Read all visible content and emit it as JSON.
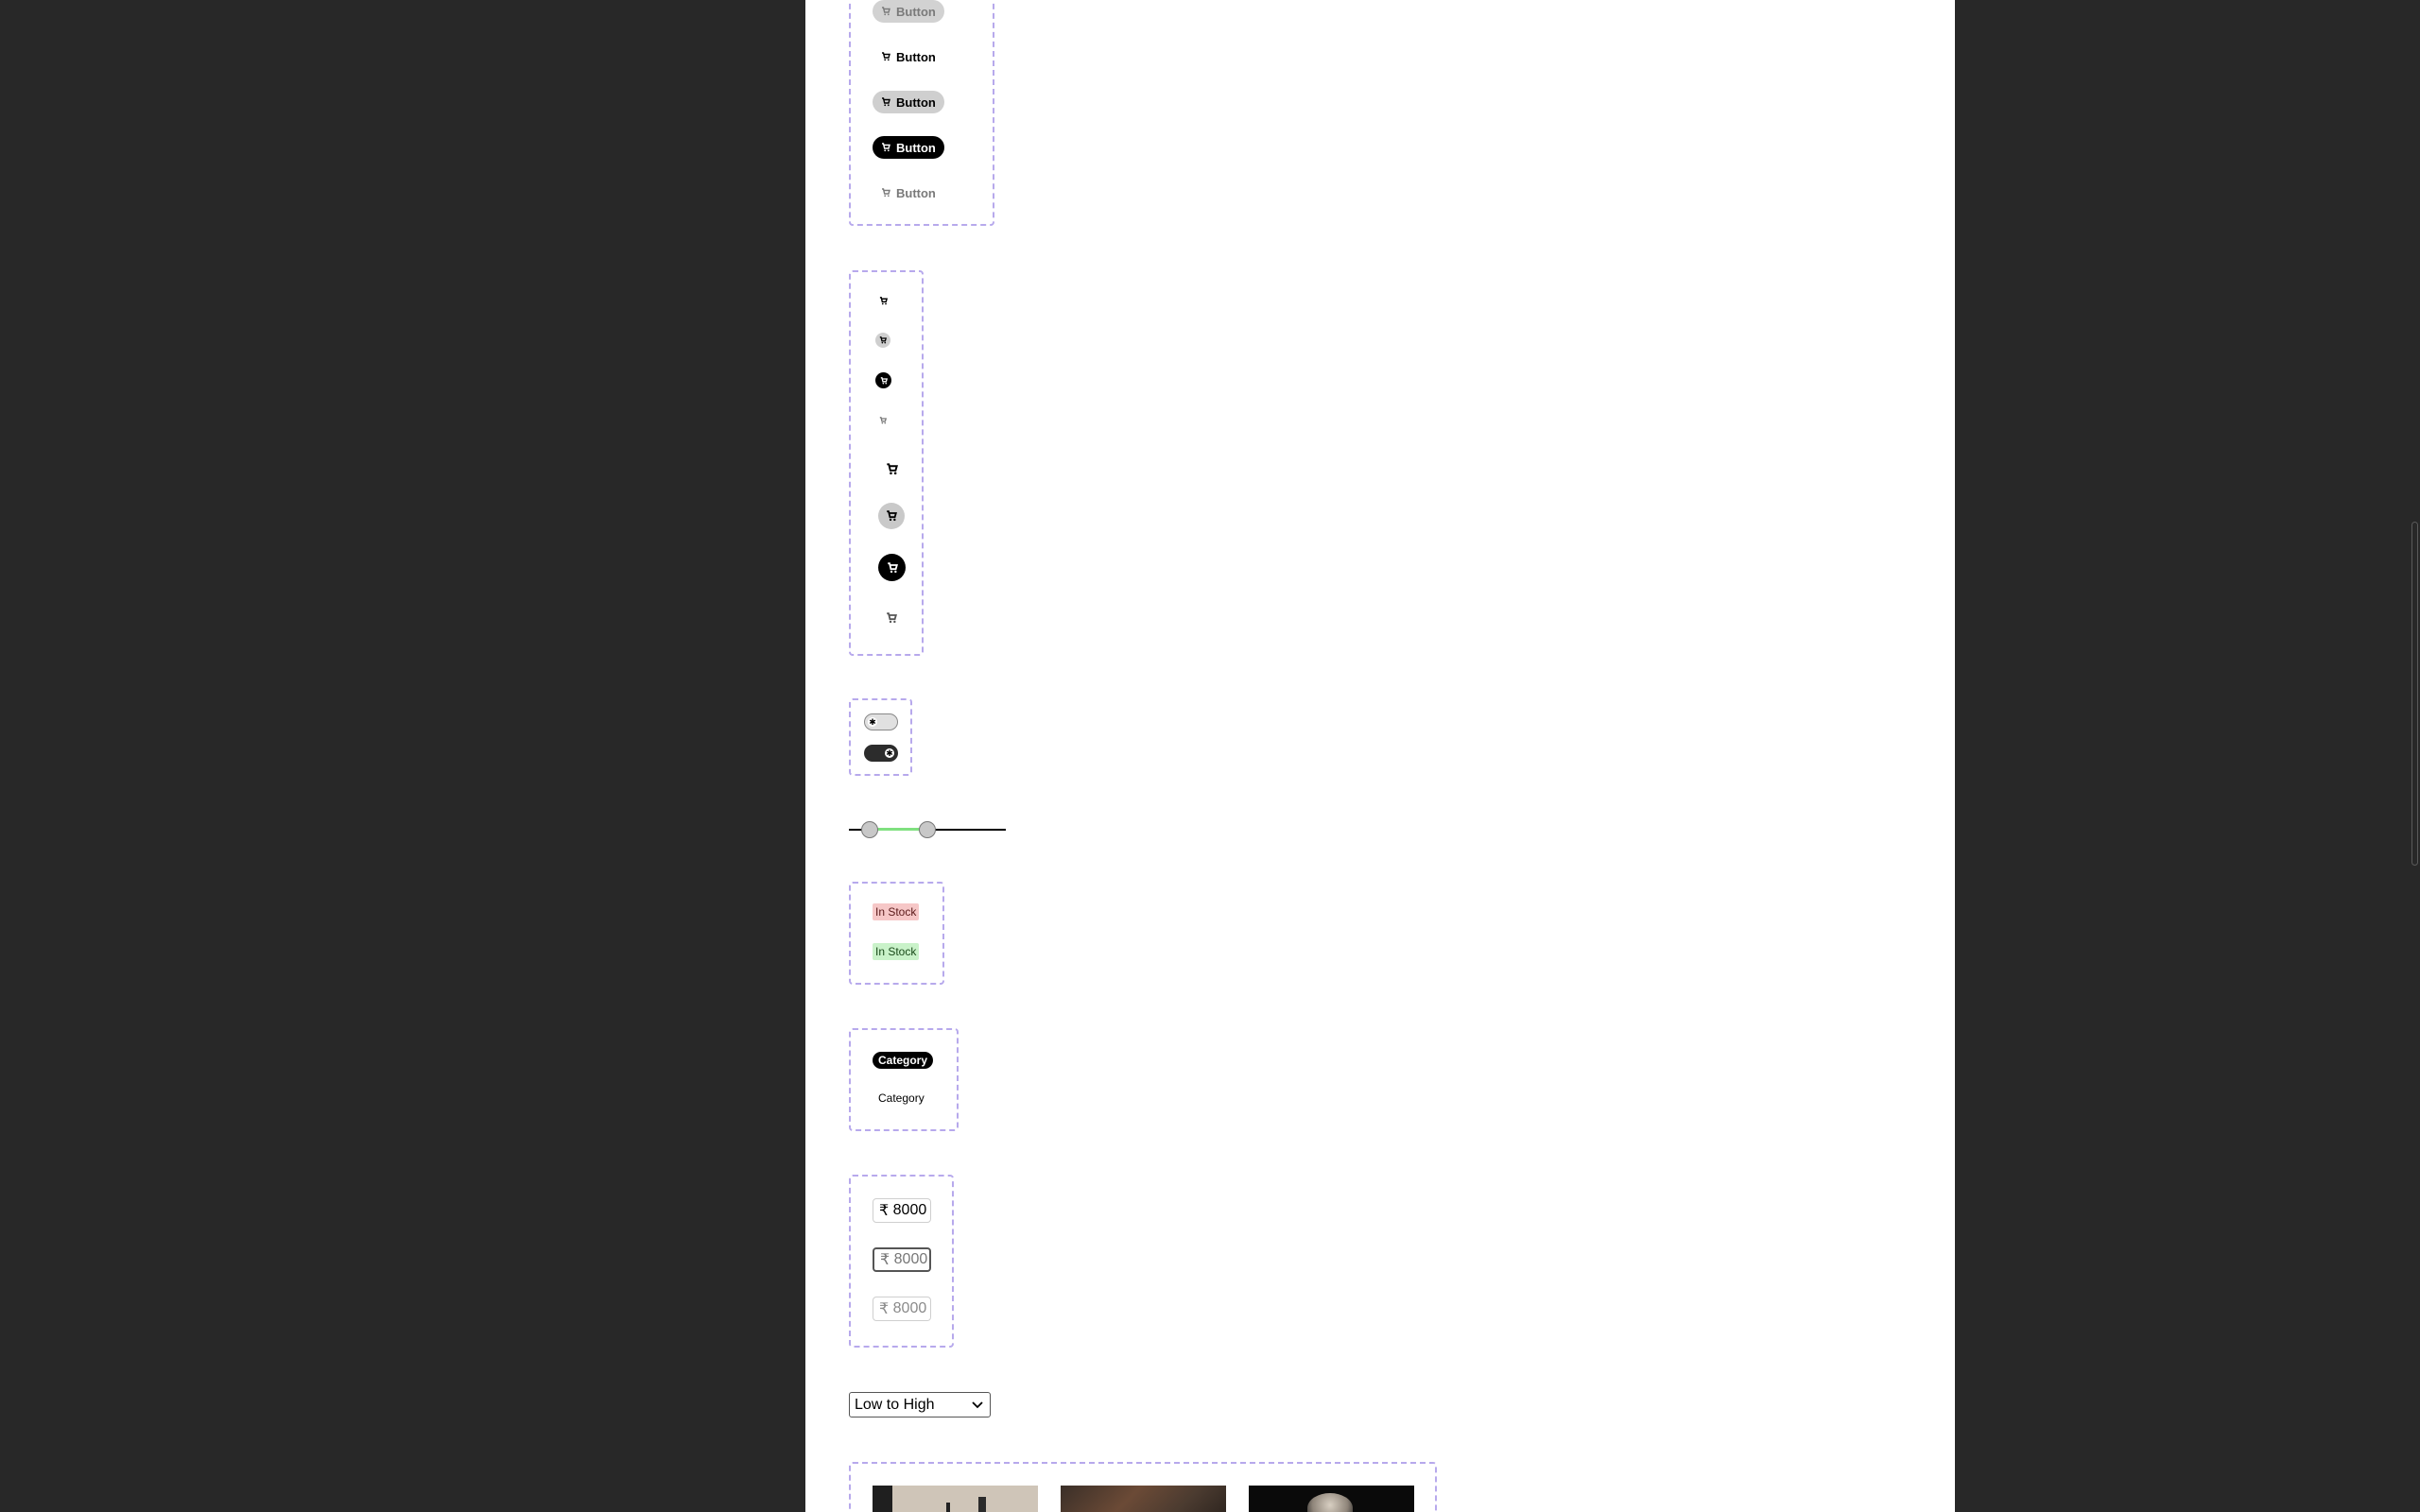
{
  "buttons": {
    "label": "Button",
    "variants": [
      "soft",
      "plain",
      "soft-dark",
      "solid",
      "ghost"
    ]
  },
  "icon_buttons": {
    "icon": "cart-icon",
    "variants": [
      "plain",
      "soft",
      "solid",
      "ghost"
    ],
    "sizes": [
      "small",
      "large"
    ]
  },
  "toggles": {
    "states": [
      "off",
      "on"
    ],
    "knob_glyph": "✱"
  },
  "range_slider": {
    "track_color": "#000000",
    "active_color": "#7fe07f"
  },
  "stock_badges": {
    "items": [
      {
        "label": "In Stock",
        "color": "#f6c7c7"
      },
      {
        "label": "In Stock",
        "color": "#c9f2c9"
      }
    ]
  },
  "category_pills": {
    "items": [
      {
        "label": "Category",
        "style": "selected"
      },
      {
        "label": "Category",
        "style": "default"
      }
    ]
  },
  "price_inputs": {
    "items": [
      {
        "currency": "₹",
        "value": "8000",
        "state": "filled"
      },
      {
        "currency": "₹",
        "value": "8000",
        "state": "focused"
      },
      {
        "currency": "₹",
        "value": "8000",
        "state": "disabled"
      }
    ]
  },
  "sort_select": {
    "value": "Low to High",
    "chevron": "chevron-down-icon"
  },
  "colors": {
    "page_bg": "#282828",
    "canvas_bg": "#ffffff",
    "dashed_border": "#b7a9ec"
  }
}
